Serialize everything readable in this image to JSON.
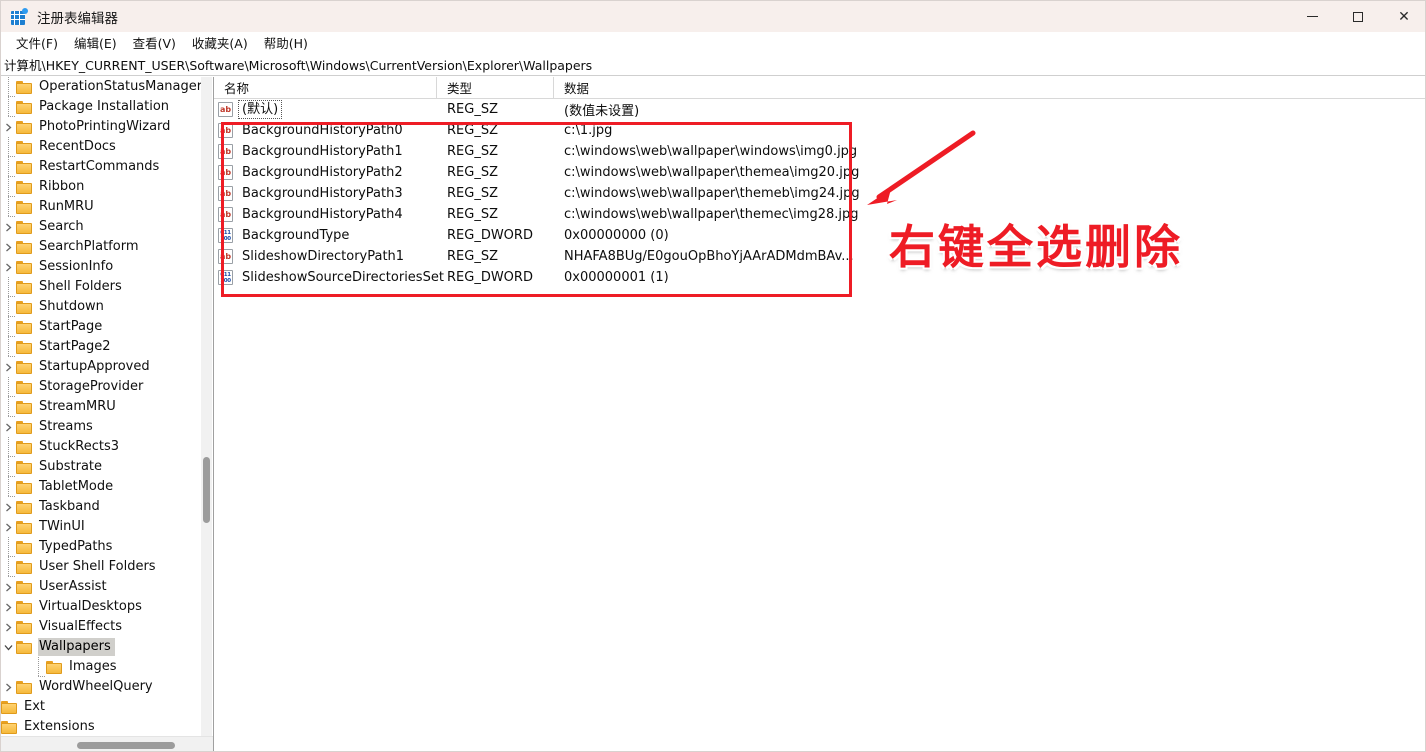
{
  "window": {
    "title": "注册表编辑器",
    "app_icon": "registry-editor-icon",
    "minimize_label": "最小化",
    "maximize_label": "最大化",
    "close_label": "关闭"
  },
  "menubar": {
    "items": [
      {
        "label": "文件(F)"
      },
      {
        "label": "编辑(E)"
      },
      {
        "label": "查看(V)"
      },
      {
        "label": "收藏夹(A)"
      },
      {
        "label": "帮助(H)"
      }
    ]
  },
  "address": {
    "path": "计算机\\HKEY_CURRENT_USER\\Software\\Microsoft\\Windows\\CurrentVersion\\Explorer\\Wallpapers"
  },
  "tree": {
    "items": [
      {
        "label": "OperationStatusManager",
        "depth": 1,
        "expandable": false,
        "selected": false
      },
      {
        "label": "Package Installation",
        "depth": 1,
        "expandable": false,
        "selected": false
      },
      {
        "label": "PhotoPrintingWizard",
        "depth": 1,
        "expandable": true,
        "selected": false
      },
      {
        "label": "RecentDocs",
        "depth": 1,
        "expandable": false,
        "selected": false
      },
      {
        "label": "RestartCommands",
        "depth": 1,
        "expandable": false,
        "selected": false
      },
      {
        "label": "Ribbon",
        "depth": 1,
        "expandable": false,
        "selected": false
      },
      {
        "label": "RunMRU",
        "depth": 1,
        "expandable": false,
        "selected": false
      },
      {
        "label": "Search",
        "depth": 1,
        "expandable": true,
        "selected": false
      },
      {
        "label": "SearchPlatform",
        "depth": 1,
        "expandable": true,
        "selected": false
      },
      {
        "label": "SessionInfo",
        "depth": 1,
        "expandable": true,
        "selected": false
      },
      {
        "label": "Shell Folders",
        "depth": 1,
        "expandable": false,
        "selected": false
      },
      {
        "label": "Shutdown",
        "depth": 1,
        "expandable": false,
        "selected": false
      },
      {
        "label": "StartPage",
        "depth": 1,
        "expandable": false,
        "selected": false
      },
      {
        "label": "StartPage2",
        "depth": 1,
        "expandable": false,
        "selected": false
      },
      {
        "label": "StartupApproved",
        "depth": 1,
        "expandable": true,
        "selected": false
      },
      {
        "label": "StorageProvider",
        "depth": 1,
        "expandable": false,
        "selected": false
      },
      {
        "label": "StreamMRU",
        "depth": 1,
        "expandable": false,
        "selected": false
      },
      {
        "label": "Streams",
        "depth": 1,
        "expandable": true,
        "selected": false
      },
      {
        "label": "StuckRects3",
        "depth": 1,
        "expandable": false,
        "selected": false
      },
      {
        "label": "Substrate",
        "depth": 1,
        "expandable": false,
        "selected": false
      },
      {
        "label": "TabletMode",
        "depth": 1,
        "expandable": false,
        "selected": false
      },
      {
        "label": "Taskband",
        "depth": 1,
        "expandable": true,
        "selected": false
      },
      {
        "label": "TWinUI",
        "depth": 1,
        "expandable": true,
        "selected": false
      },
      {
        "label": "TypedPaths",
        "depth": 1,
        "expandable": false,
        "selected": false
      },
      {
        "label": "User Shell Folders",
        "depth": 1,
        "expandable": false,
        "selected": false
      },
      {
        "label": "UserAssist",
        "depth": 1,
        "expandable": true,
        "selected": false
      },
      {
        "label": "VirtualDesktops",
        "depth": 1,
        "expandable": true,
        "selected": false
      },
      {
        "label": "VisualEffects",
        "depth": 1,
        "expandable": true,
        "selected": false
      },
      {
        "label": "Wallpapers",
        "depth": 1,
        "expandable": true,
        "expanded": true,
        "selected": true
      },
      {
        "label": "Images",
        "depth": 2,
        "expandable": false,
        "selected": false
      },
      {
        "label": "WordWheelQuery",
        "depth": 1,
        "expandable": true,
        "selected": false
      },
      {
        "label": "Ext",
        "depth": 0,
        "expandable": false,
        "selected": false
      },
      {
        "label": "Extensions",
        "depth": 0,
        "expandable": false,
        "selected": false
      }
    ]
  },
  "list": {
    "columns": [
      {
        "label": "名称"
      },
      {
        "label": "类型"
      },
      {
        "label": "数据"
      }
    ],
    "rows": [
      {
        "name": "(默认)",
        "type": "REG_SZ",
        "data": "(数值未设置)",
        "icon": "string-value-icon",
        "is_default": true
      },
      {
        "name": "BackgroundHistoryPath0",
        "type": "REG_SZ",
        "data": "c:\\1.jpg",
        "icon": "string-value-icon",
        "is_default": false
      },
      {
        "name": "BackgroundHistoryPath1",
        "type": "REG_SZ",
        "data": "c:\\windows\\web\\wallpaper\\windows\\img0.jpg",
        "icon": "string-value-icon",
        "is_default": false
      },
      {
        "name": "BackgroundHistoryPath2",
        "type": "REG_SZ",
        "data": "c:\\windows\\web\\wallpaper\\themea\\img20.jpg",
        "icon": "string-value-icon",
        "is_default": false
      },
      {
        "name": "BackgroundHistoryPath3",
        "type": "REG_SZ",
        "data": "c:\\windows\\web\\wallpaper\\themeb\\img24.jpg",
        "icon": "string-value-icon",
        "is_default": false
      },
      {
        "name": "BackgroundHistoryPath4",
        "type": "REG_SZ",
        "data": "c:\\windows\\web\\wallpaper\\themec\\img28.jpg",
        "icon": "string-value-icon",
        "is_default": false
      },
      {
        "name": "BackgroundType",
        "type": "REG_DWORD",
        "data": "0x00000000 (0)",
        "icon": "dword-value-icon",
        "is_default": false
      },
      {
        "name": "SlideshowDirectoryPath1",
        "type": "REG_SZ",
        "data": "NHAFA8BUg/E0gouOpBhoYjAArADMdmBAv...",
        "icon": "string-value-icon",
        "is_default": false
      },
      {
        "name": "SlideshowSourceDirectoriesSet",
        "type": "REG_DWORD",
        "data": "0x00000001 (1)",
        "icon": "dword-value-icon",
        "is_default": false
      }
    ]
  },
  "annotation": {
    "text": "右键全选删除",
    "color": "#ee1c25",
    "arrow": "diagonal-arrow-pointing-left"
  }
}
